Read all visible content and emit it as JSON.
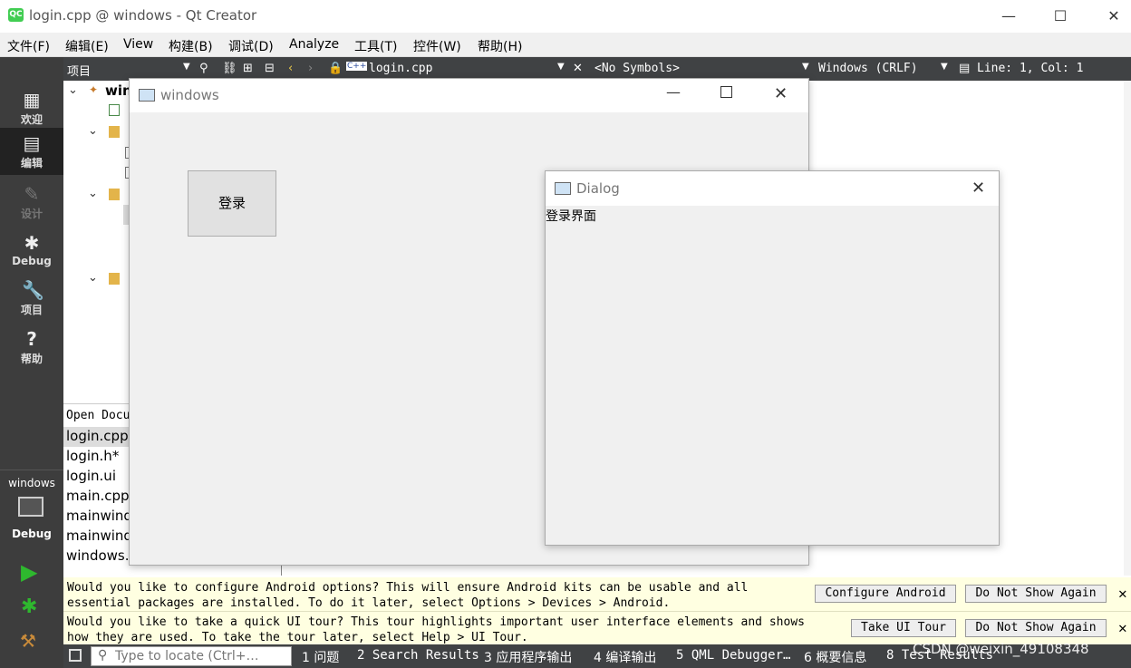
{
  "app": {
    "title": "login.cpp @ windows - Qt Creator",
    "icon": "QC"
  },
  "window_controls": {
    "minimize": "—",
    "maximize": "☐",
    "close": "✕"
  },
  "menus": [
    "文件(F)",
    "编辑(E)",
    "View",
    "构建(B)",
    "调试(D)",
    "Analyze",
    "工具(T)",
    "控件(W)",
    "帮助(H)"
  ],
  "modes": [
    {
      "label": "欢迎",
      "icon": "grid-icon"
    },
    {
      "label": "编辑",
      "icon": "edit-icon"
    },
    {
      "label": "设计",
      "icon": "pencil-icon"
    },
    {
      "label": "Debug",
      "icon": "bug-icon"
    },
    {
      "label": "项目",
      "icon": "wrench-icon"
    },
    {
      "label": "帮助",
      "icon": "help-icon"
    }
  ],
  "kit": {
    "name": "windows",
    "config": "Debug"
  },
  "toolbar": {
    "project_label": "项目",
    "file": "login.cpp",
    "symbols": "<No Symbols>",
    "line_ending": "Windows (CRLF)",
    "position": "Line: 1, Col: 1"
  },
  "tree": {
    "root": "win"
  },
  "open_documents": {
    "header": "Open Docu",
    "items": [
      "login.cpp",
      "login.h*",
      "login.ui",
      "main.cpp",
      "mainwind",
      "mainwind",
      "windows."
    ]
  },
  "info_bars": [
    {
      "line1": "Would you like to configure Android options? This will ensure Android kits can be usable and all",
      "line2": "essential packages are installed. To do it later, select Options > Devices > Android.",
      "button": "Configure Android",
      "dismiss": "Do Not Show Again"
    },
    {
      "line1": "Would you like to take a quick UI tour? This tour highlights important user interface elements and shows",
      "line2": "how they are used. To take the tour later, select Help > UI Tour.",
      "button": "Take UI Tour",
      "dismiss": "Do Not Show Again"
    }
  ],
  "statusbar": {
    "locate_placeholder": "Type to locate (Ctrl+…",
    "panes": [
      "1 问题",
      "2 Search Results",
      "3 应用程序输出",
      "4 编译输出",
      "5 QML Debugger…",
      "6 概要信息",
      "8 Test Results"
    ],
    "watermark": "CSDN @weixin_49108348"
  },
  "windows_dialog": {
    "title": "windows",
    "button": "登录"
  },
  "dialog": {
    "title": "Dialog",
    "label": "登录界面"
  }
}
